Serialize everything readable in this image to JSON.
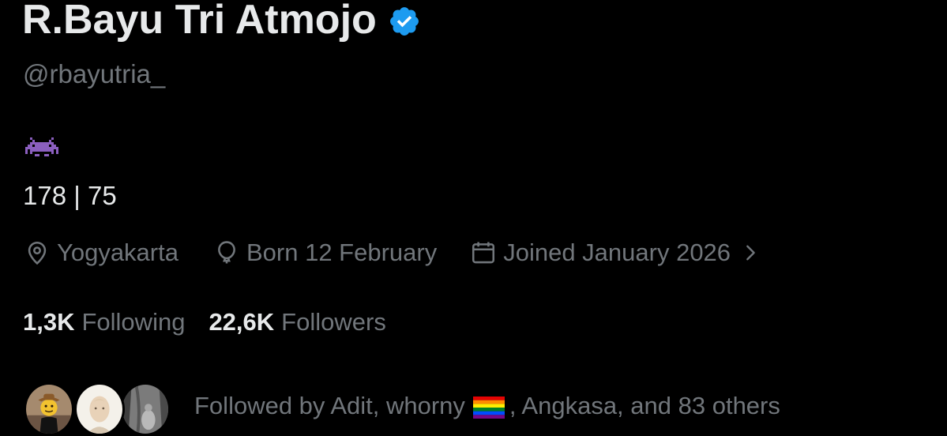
{
  "profile": {
    "display_name": "R.Bayu Tri Atmojo",
    "verified": true,
    "verified_color": "#1d9bf0",
    "handle": "@rbayutria_",
    "bio_emoji": "alien-monster-icon",
    "bio_emoji_color": "#8b5fbf",
    "bio_text": "178 | 75"
  },
  "meta": {
    "location": "Yogyakarta",
    "location_icon": "location-pin-icon",
    "birthday": "Born 12 February",
    "birthday_icon": "balloon-icon",
    "joined": "Joined January 2026",
    "joined_icon": "calendar-icon"
  },
  "stats": {
    "following_count": "1,3K",
    "following_label": "Following",
    "followers_count": "22,6K",
    "followers_label": "Followers"
  },
  "followed_by": {
    "prefix": "Followed by Adit, whorny",
    "flag": "rainbow-flag-icon",
    "suffix": ", Angkasa, and 83 others"
  },
  "colors": {
    "background": "#000000",
    "primary_text": "#e7e9ea",
    "secondary_text": "#71767b"
  }
}
